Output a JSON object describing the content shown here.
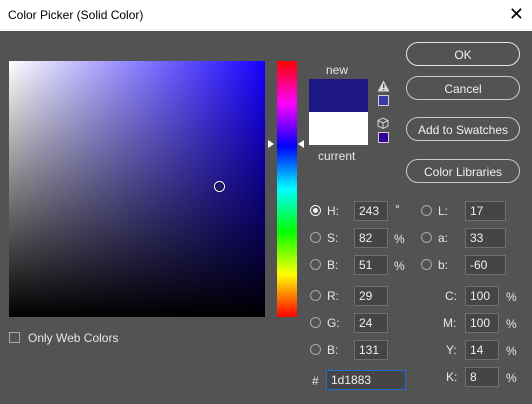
{
  "window": {
    "title": "Color Picker (Solid Color)",
    "close_glyph": "✕"
  },
  "swatch": {
    "new_label": "new",
    "current_label": "current",
    "new_color": "#1d1883",
    "current_color": "#ffffff"
  },
  "buttons": {
    "ok": "OK",
    "cancel": "Cancel",
    "add_to_swatches": "Add to Swatches",
    "color_libraries": "Color Libraries"
  },
  "fields": {
    "h": {
      "label": "H:",
      "value": "243",
      "unit": "°",
      "selected": true
    },
    "s": {
      "label": "S:",
      "value": "82",
      "unit": "%"
    },
    "b": {
      "label": "B:",
      "value": "51",
      "unit": "%"
    },
    "r": {
      "label": "R:",
      "value": "29"
    },
    "g": {
      "label": "G:",
      "value": "24"
    },
    "bb": {
      "label": "B:",
      "value": "131"
    },
    "l": {
      "label": "L:",
      "value": "17"
    },
    "a": {
      "label": "a:",
      "value": "33"
    },
    "lab_b": {
      "label": "b:",
      "value": "-60"
    },
    "c": {
      "label": "C:",
      "value": "100",
      "unit": "%"
    },
    "m": {
      "label": "M:",
      "value": "100",
      "unit": "%"
    },
    "y": {
      "label": "Y:",
      "value": "14",
      "unit": "%"
    },
    "k": {
      "label": "K:",
      "value": "8",
      "unit": "%"
    },
    "hex": {
      "label": "#",
      "value": "1d1883"
    }
  },
  "only_web_colors": {
    "label": "Only Web Colors",
    "checked": false
  },
  "picker": {
    "hue_degrees": 243,
    "saturation": 0.82,
    "brightness": 0.51
  },
  "icons": {
    "gamut_warning": "warning-icon",
    "web_safe": "cube-icon"
  },
  "colors": {
    "background": "#535353",
    "gamut_swatch": "#3a3aa8",
    "websafe_swatch": "#330099",
    "hex_focus": "#1f6fd2"
  }
}
